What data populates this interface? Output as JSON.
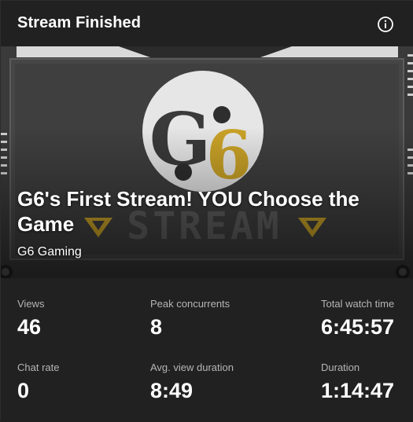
{
  "header": {
    "title": "Stream Finished",
    "info_icon": "info-icon"
  },
  "stream": {
    "title": "G6's First Stream! YOU Choose the Game",
    "channel": "G6 Gaming",
    "thumbnail": {
      "logo_text": "G6",
      "banner_text": "STREAM"
    }
  },
  "stats": [
    {
      "label": "Views",
      "value": "46"
    },
    {
      "label": "Peak concurrents",
      "value": "8"
    },
    {
      "label": "Total watch time",
      "value": "6:45:57"
    },
    {
      "label": "Chat rate",
      "value": "0"
    },
    {
      "label": "Avg. view duration",
      "value": "8:49"
    },
    {
      "label": "Duration",
      "value": "1:14:47"
    }
  ],
  "colors": {
    "background": "#212121",
    "label": "#b5b5b5",
    "logo_gold": "#c9a227"
  }
}
